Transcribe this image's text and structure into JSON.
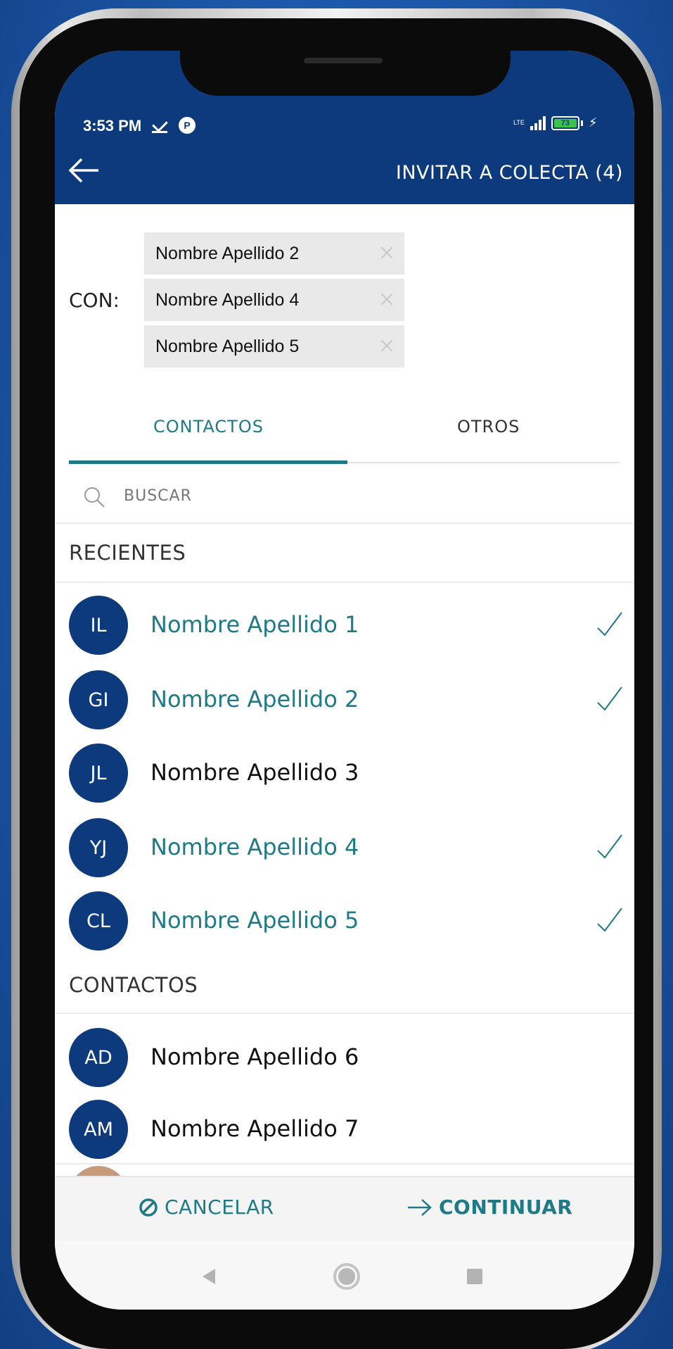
{
  "status_bar": {
    "time": "3:53 PM",
    "network": "LTE",
    "battery": "73"
  },
  "appbar": {
    "title": "INVITAR A COLECTA (4)"
  },
  "recipients": {
    "label": "CON:",
    "chips": [
      "Nombre Apellido 2",
      "Nombre Apellido 4",
      "Nombre Apellido 5"
    ]
  },
  "tabs": {
    "active": "CONTACTOS",
    "items": [
      "CONTACTOS",
      "OTROS"
    ]
  },
  "search": {
    "placeholder": "BUSCAR"
  },
  "sections": {
    "recent_title": "RECIENTES",
    "contacts_title": "CONTACTOS"
  },
  "recent": [
    {
      "initials": "IL",
      "name": "Nombre Apellido 1",
      "selected": true
    },
    {
      "initials": "GI",
      "name": "Nombre Apellido 2",
      "selected": true
    },
    {
      "initials": "JL",
      "name": "Nombre Apellido 3",
      "selected": false
    },
    {
      "initials": "YJ",
      "name": "Nombre Apellido 4",
      "selected": true
    },
    {
      "initials": "CL",
      "name": "Nombre Apellido 5",
      "selected": true
    }
  ],
  "contacts": [
    {
      "initials": "AD",
      "name": "Nombre Apellido 6",
      "selected": false
    },
    {
      "initials": "AM",
      "name": "Nombre Apellido 7",
      "selected": false
    }
  ],
  "actions": {
    "cancel": "CANCELAR",
    "continue": "CONTINUAR"
  },
  "colors": {
    "brand_blue": "#0c3a7d",
    "accent_teal": "#1d7a86"
  }
}
